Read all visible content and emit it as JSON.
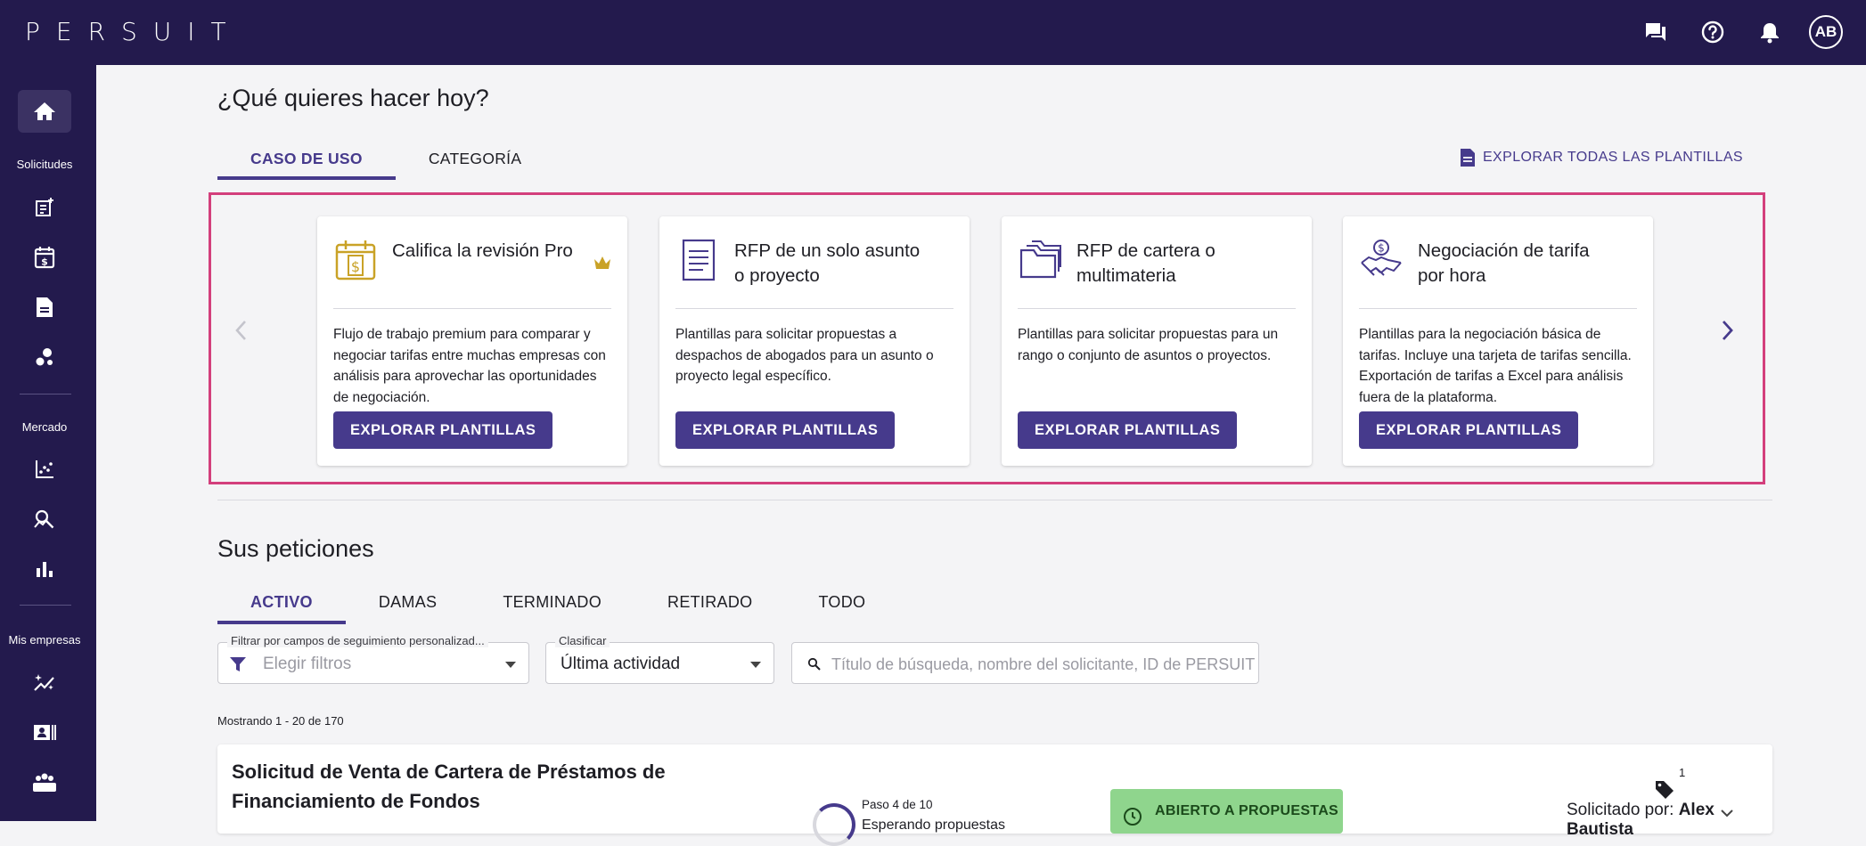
{
  "brand": "PERSUIT",
  "colors": {
    "nav_bg": "#231a4d",
    "accent": "#463a8c",
    "highlight": "#d33f7c",
    "status_green": "#8fd58d"
  },
  "header": {
    "icons": [
      "chat-icon",
      "help-icon",
      "bell-icon"
    ],
    "avatar_initials": "AB"
  },
  "sidebar": {
    "section_requests": "Solicitudes",
    "section_market": "Mercado",
    "section_firms": "Mis empresas",
    "icons": [
      "home-icon",
      "new-request-icon",
      "calendar-dollar-icon",
      "document-icon",
      "molecule-icon",
      "scatter-chart-icon",
      "search-analytics-icon",
      "bar-chart-icon",
      "sparkle-chart-icon",
      "contact-card-icon",
      "group-icon"
    ]
  },
  "templates": {
    "heading": "¿Qué quieres hacer hoy?",
    "tabs": [
      "CASO DE USO",
      "CATEGORÍA"
    ],
    "active_tab": "CASO DE USO",
    "explore_all": "EXPLORAR TODAS LAS PLANTILLAS",
    "cards": [
      {
        "title": "Califica la revisión Pro",
        "description": "Flujo de trabajo premium para comparar y negociar tarifas entre muchas empresas con análisis para aprovechar las oportunidades de negociación.",
        "button": "EXPLORAR PLANTILLAS",
        "icon": "calendar-dollar-icon",
        "premium": true
      },
      {
        "title": "RFP de un solo asunto o proyecto",
        "description": "Plantillas para solicitar propuestas a despachos de abogados para un asunto o proyecto legal específico.",
        "button": "EXPLORAR PLANTILLAS",
        "icon": "document-lines-icon"
      },
      {
        "title": "RFP de cartera o multimateria",
        "description": "Plantillas para solicitar propuestas para un rango o conjunto de asuntos o proyectos.",
        "button": "EXPLORAR PLANTILLAS",
        "icon": "folders-icon"
      },
      {
        "title": "Negociación de tarifa por hora",
        "description": "Plantillas para la negociación básica de tarifas. Incluye una tarjeta de tarifas sencilla. Exportación de tarifas a Excel para análisis fuera de la plataforma.",
        "button": "EXPLORAR PLANTILLAS",
        "icon": "handshake-dollar-icon"
      }
    ]
  },
  "requests": {
    "heading": "Sus peticiones",
    "tabs": [
      "ACTIVO",
      "DAMAS",
      "TERMINADO",
      "RETIRADO",
      "TODO"
    ],
    "active_tab": "ACTIVO",
    "filter": {
      "label": "Filtrar por campos de seguimiento personalizad...",
      "placeholder": "Elegir filtros"
    },
    "sort": {
      "label": "Clasificar",
      "value": "Última actividad"
    },
    "search": {
      "placeholder": "Título de búsqueda, nombre del solicitante, ID de PERSUIT"
    },
    "showing": "Mostrando 1 - 20 de 170",
    "items": [
      {
        "title": "Solicitud de Venta de Cartera de Préstamos de Financiamiento de Fondos",
        "step": "Paso 4 de 10",
        "step_progress": 0.4,
        "step_sub": "Esperando propuestas",
        "status": "ABIERTO A PROPUESTAS",
        "tag_count": "1",
        "requested_by_label": "Solicitado por:",
        "requested_by": "Alex Bautista"
      }
    ]
  }
}
